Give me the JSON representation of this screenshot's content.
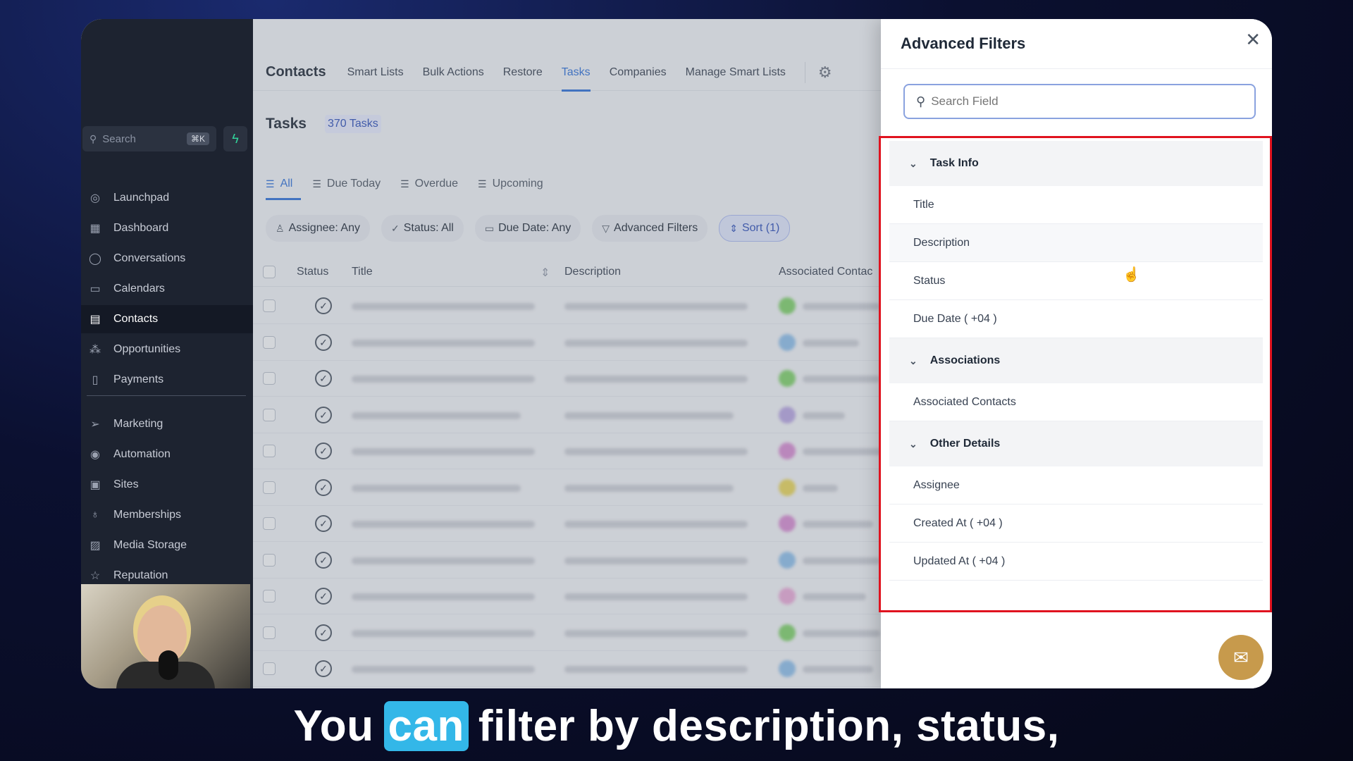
{
  "sidebar": {
    "search_placeholder": "Search",
    "search_shortcut": "⌘K",
    "items_top": [
      {
        "label": "Launchpad",
        "icon": "rocket-icon",
        "glyph": "◎",
        "active": false
      },
      {
        "label": "Dashboard",
        "icon": "dashboard-icon",
        "glyph": "▦",
        "active": false
      },
      {
        "label": "Conversations",
        "icon": "chat-bubble-icon",
        "glyph": "◯",
        "active": false
      },
      {
        "label": "Calendars",
        "icon": "calendar-icon",
        "glyph": "▭",
        "active": false
      },
      {
        "label": "Contacts",
        "icon": "contacts-icon",
        "glyph": "▤",
        "active": true
      },
      {
        "label": "Opportunities",
        "icon": "opportunities-icon",
        "glyph": "⁂",
        "active": false
      },
      {
        "label": "Payments",
        "icon": "payments-icon",
        "glyph": "▯",
        "active": false
      }
    ],
    "items_bottom": [
      {
        "label": "Marketing",
        "icon": "send-icon",
        "glyph": "➢"
      },
      {
        "label": "Automation",
        "icon": "automation-icon",
        "glyph": "◉"
      },
      {
        "label": "Sites",
        "icon": "sites-icon",
        "glyph": "▣"
      },
      {
        "label": "Memberships",
        "icon": "membership-icon",
        "glyph": "♁"
      },
      {
        "label": "Media Storage",
        "icon": "media-icon",
        "glyph": "▨"
      },
      {
        "label": "Reputation",
        "icon": "star-icon",
        "glyph": "☆"
      }
    ]
  },
  "topnav": {
    "title": "Contacts",
    "links": [
      {
        "label": "Smart Lists",
        "active": false
      },
      {
        "label": "Bulk Actions",
        "active": false
      },
      {
        "label": "Restore",
        "active": false
      },
      {
        "label": "Tasks",
        "active": true
      },
      {
        "label": "Companies",
        "active": false
      },
      {
        "label": "Manage Smart Lists",
        "active": false
      }
    ]
  },
  "tasks": {
    "title": "Tasks",
    "count": "370 Tasks",
    "subtabs": [
      {
        "label": "All",
        "active": true
      },
      {
        "label": "Due Today",
        "active": false
      },
      {
        "label": "Overdue",
        "active": false
      },
      {
        "label": "Upcoming",
        "active": false
      }
    ],
    "filters": [
      {
        "label": "Assignee: Any",
        "icon": "user-icon",
        "glyph": "♙"
      },
      {
        "label": "Status: All",
        "icon": "check-icon",
        "glyph": "✓"
      },
      {
        "label": "Due Date: Any",
        "icon": "calendar-icon",
        "glyph": "▭"
      },
      {
        "label": "Advanced Filters",
        "icon": "filter-icon",
        "glyph": "▽"
      }
    ],
    "sort_label": "Sort (1)",
    "columns": {
      "status": "Status",
      "title": "Title",
      "description": "Description",
      "associated": "Associated Contac"
    },
    "row_count": 12,
    "contact_colors": [
      "#7fcf6a",
      "#8dbde8",
      "#7fcf6a",
      "#b6a4e0",
      "#d58bd0",
      "#e6d35a",
      "#d58bd0",
      "#8dbde8",
      "#e7a8d6",
      "#7fcf6a",
      "#8dbde8",
      "#b6a4e0"
    ]
  },
  "drawer": {
    "title": "Advanced Filters",
    "search_placeholder": "Search Field",
    "groups": [
      {
        "label": "Task Info",
        "items": [
          "Title",
          "Description",
          "Status",
          "Due Date ( +04 )"
        ]
      },
      {
        "label": "Associations",
        "items": [
          "Associated Contacts"
        ]
      },
      {
        "label": "Other Details",
        "items": [
          "Assignee",
          "Created At ( +04 )",
          "Updated At ( +04 )"
        ]
      }
    ]
  },
  "caption": {
    "before": "You",
    "highlight": "can",
    "after": "filter by description, status,"
  },
  "colors": {
    "accent": "#2f6fd6",
    "highlight_box": "#e0131f",
    "caption_highlight": "#33b7e8",
    "chat_button": "#c79a4c",
    "sidebar_bg": "#1d2330"
  }
}
